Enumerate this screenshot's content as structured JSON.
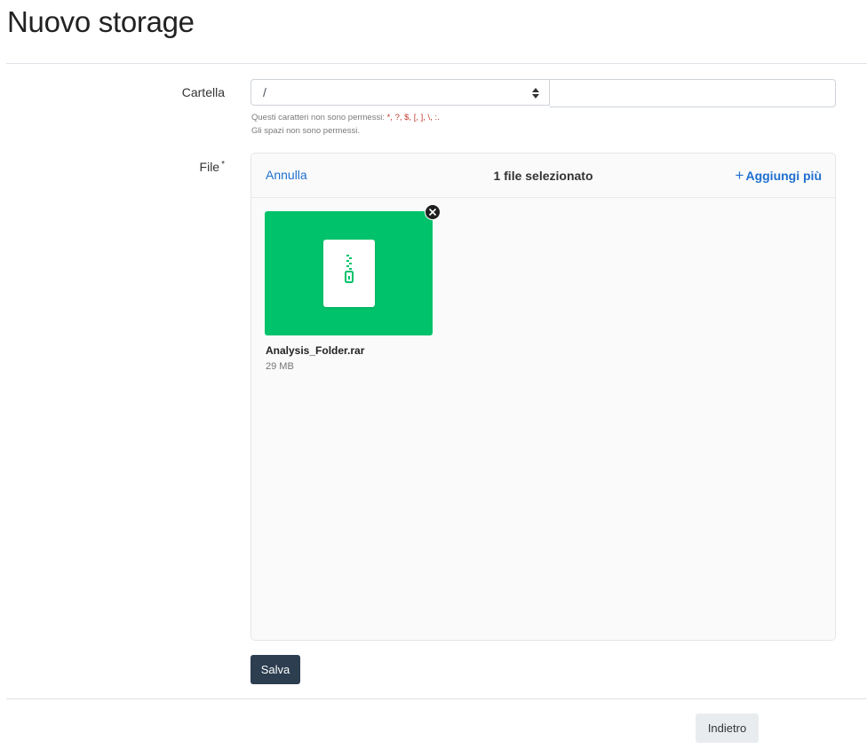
{
  "page": {
    "title": "Nuovo storage"
  },
  "form": {
    "folder": {
      "label": "Cartella",
      "selected_value": "/",
      "input_value": "",
      "help_line1_prefix": "Questi caratteri non sono permessi: ",
      "help_forbidden_chars": "*, ?, $, [, ], \\, :.",
      "help_line2": "Gli spazi non sono permessi."
    },
    "file": {
      "label": "File",
      "required_marker": "*"
    }
  },
  "uploader": {
    "cancel_label": "Annulla",
    "count_label": "1 file selezionato",
    "add_more_label": "Aggiungi più",
    "files": [
      {
        "name": "Analysis_Folder.rar",
        "size": "29 MB",
        "icon": "zip-archive-icon"
      }
    ]
  },
  "actions": {
    "save_label": "Salva",
    "back_label": "Indietro"
  },
  "colors": {
    "file_thumb": "#00c26a",
    "link": "#1f6fcf",
    "save_button": "#2c3e50",
    "forbidden_chars": "#c0392b"
  }
}
